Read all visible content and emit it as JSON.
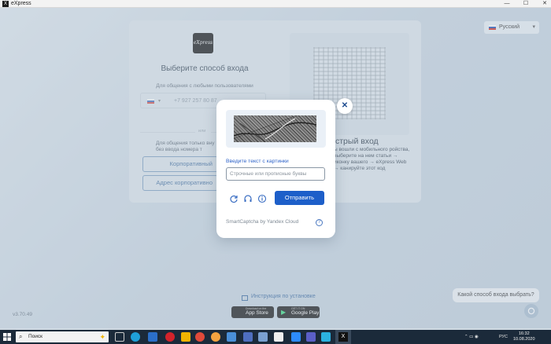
{
  "window": {
    "title": "eXpress",
    "minimize": "—",
    "maximize": "☐",
    "close": "✕"
  },
  "language": {
    "selected": "Русский"
  },
  "login": {
    "logo_text": "eXpress",
    "title": "Выберите способ входа",
    "contact_hint": "Для общения с любыми пользователями",
    "phone_value": "+7 927 257 80 87",
    "or_text": "или",
    "corp_hint": "Для общения только вну без ввода номера т",
    "corp_button": "Корпоративный",
    "corp_address_button": "Адрес корпоративно"
  },
  "quick_login": {
    "title": "стрый вход",
    "text": "ы вошли с мобильного ройства, выберите на нем статьи → иконку вашего → eXpress Web → канируйте этот код"
  },
  "captcha": {
    "label": "Введите текст с картинки",
    "placeholder": "Строчные или прописные буквы",
    "value": "",
    "submit": "Отправить",
    "brand": "SmartCaptcha by Yandex Cloud",
    "info": "?"
  },
  "footer": {
    "install_link": "Инструкция по установке",
    "app_store_sub": "Download on the",
    "app_store": "App Store",
    "google_play_sub": "GET IT ON",
    "google_play": "Google Play",
    "version": "v3.70.49",
    "chat_prompt": "Какой способ входа выбрать?"
  },
  "taskbar": {
    "search_placeholder": "Поиск",
    "lang": "РУС",
    "time": "16:32",
    "date": "10.08.2020"
  },
  "colors": {
    "accent": "#1d5fc9",
    "taskbar": "#1b2a3a"
  }
}
